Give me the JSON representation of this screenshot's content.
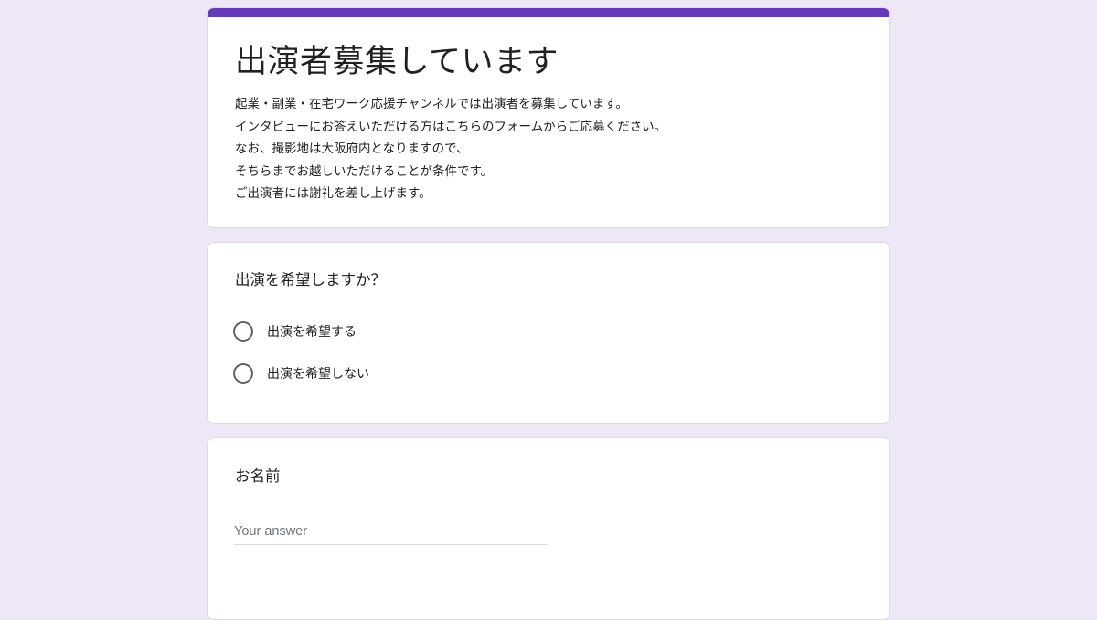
{
  "colors": {
    "background": "#ede7f6",
    "accent": "#673ab7",
    "card": "#ffffff",
    "card_border": "#dadce0"
  },
  "header": {
    "title": "出演者募集しています",
    "description": [
      "起業・副業・在宅ワーク応援チャンネルでは出演者を募集しています。",
      "インタビューにお答えいただける方はこちらのフォームからご応募ください。",
      "なお、撮影地は大阪府内となりますので、",
      "そちらまでお越しいただけることが条件です。",
      "ご出演者には謝礼を差し上げます。"
    ]
  },
  "questions": [
    {
      "title": "出演を希望しますか？",
      "type": "radio",
      "options": [
        "出演を希望する",
        "出演を希望しない"
      ],
      "selected": null
    },
    {
      "title": "お名前",
      "type": "text",
      "value": "",
      "placeholder": "Your answer"
    }
  ]
}
